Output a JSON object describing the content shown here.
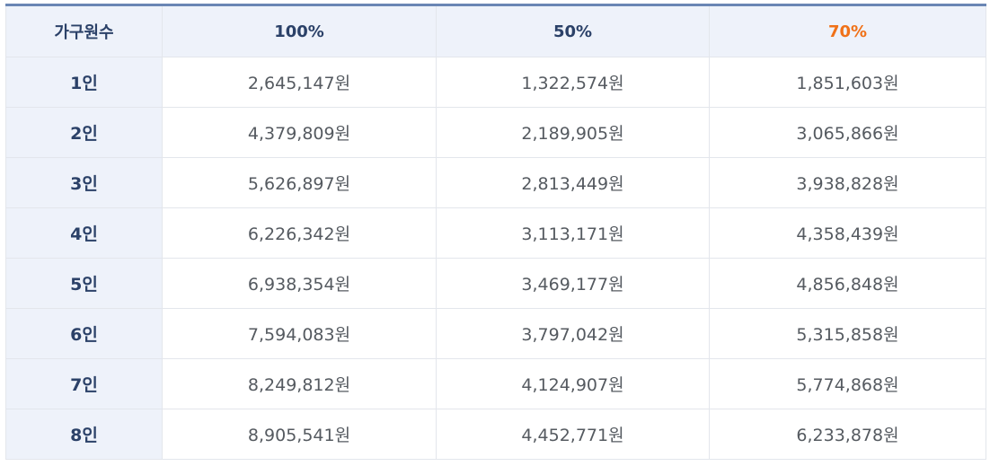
{
  "table": {
    "headers": [
      "가구원수",
      "100%",
      "50%",
      "70%"
    ],
    "highlight_color": "#f07118",
    "rows": [
      [
        "1인",
        "2,645,147원",
        "1,322,574원",
        "1,851,603원"
      ],
      [
        "2인",
        "4,379,809원",
        "2,189,905원",
        "3,065,866원"
      ],
      [
        "3인",
        "5,626,897원",
        "2,813,449원",
        "3,938,828원"
      ],
      [
        "4인",
        "6,226,342원",
        "3,113,171원",
        "4,358,439원"
      ],
      [
        "5인",
        "6,938,354원",
        "3,469,177원",
        "4,856,848원"
      ],
      [
        "6인",
        "7,594,083원",
        "3,797,042원",
        "5,315,858원"
      ],
      [
        "7인",
        "8,249,812원",
        "4,124,907원",
        "5,774,868원"
      ],
      [
        "8인",
        "8,905,541원",
        "4,452,771원",
        "6,233,878원"
      ]
    ]
  }
}
